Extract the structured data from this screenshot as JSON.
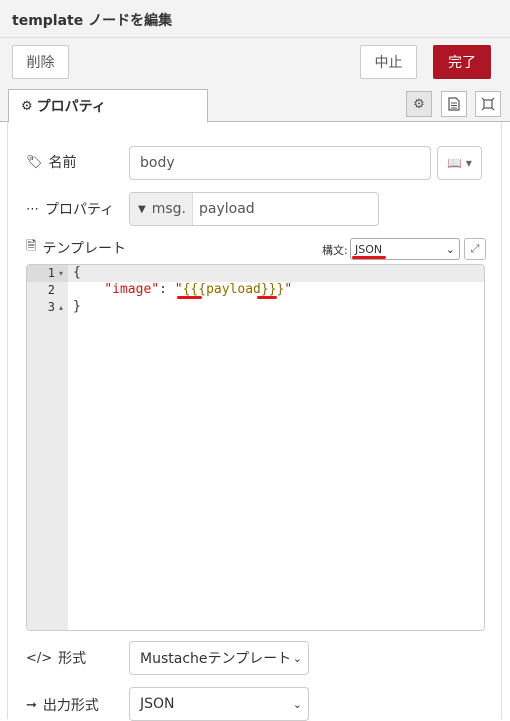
{
  "tray": {
    "title": "template ノードを編集"
  },
  "toolbar": {
    "delete_label": "削除",
    "cancel_label": "中止",
    "done_label": "完了"
  },
  "tabs": {
    "properties_label": "プロパティ",
    "settings_icon": "gear-icon",
    "description_icon": "document-icon",
    "appearance_icon": "frame-icon"
  },
  "fields": {
    "name_label": "名前",
    "name_value": "body",
    "property_label": "プロパティ",
    "property_type": "msg.",
    "property_value": "payload",
    "template_label": "テンプレート",
    "syntax_label": "構文:",
    "syntax_value": "JSON",
    "format_label": "形式",
    "format_value": "Mustacheテンプレート",
    "output_label": "出力形式",
    "output_value": "JSON"
  },
  "editor": {
    "line_numbers": [
      "1",
      "2",
      "3"
    ],
    "line1": "{",
    "line2_key": "\"image\"",
    "line2_colon": ": ",
    "line2_q1": "\"",
    "line2_value": "{{{payload}}}",
    "line2_q2": "\"",
    "line3": "}"
  },
  "colors": {
    "primary": "#ad1625",
    "annotation": "#e0161f"
  }
}
